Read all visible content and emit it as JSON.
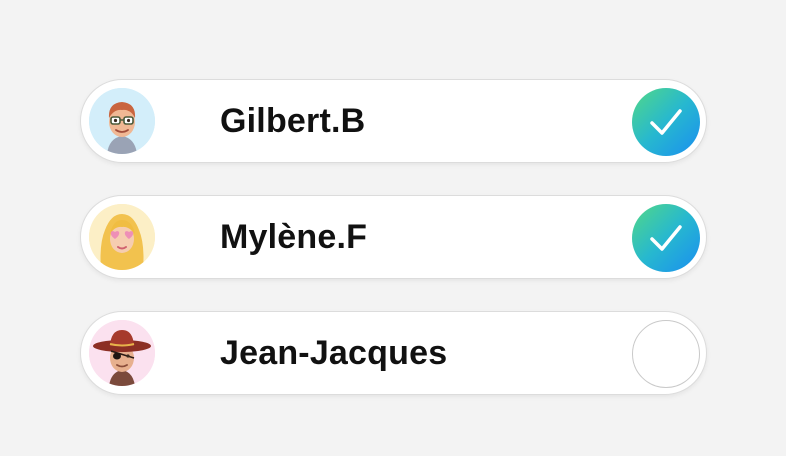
{
  "contacts": [
    {
      "name": "Gilbert.B",
      "avatar_icon": "memoji-red-hair-glasses-icon",
      "avatar_bg": "#d3eefa",
      "selected": true
    },
    {
      "name": "Mylène.F",
      "avatar_icon": "memoji-blonde-heart-glasses-icon",
      "avatar_bg": "#fcefc6",
      "selected": true
    },
    {
      "name": "Jean-Jacques",
      "avatar_icon": "memoji-sombrero-eyepatch-icon",
      "avatar_bg": "#fbe1ef",
      "selected": false
    }
  ],
  "colors": {
    "background": "#f3f3f3",
    "check_gradient_start": "#52d886",
    "check_gradient_end": "#1a8ef0"
  }
}
